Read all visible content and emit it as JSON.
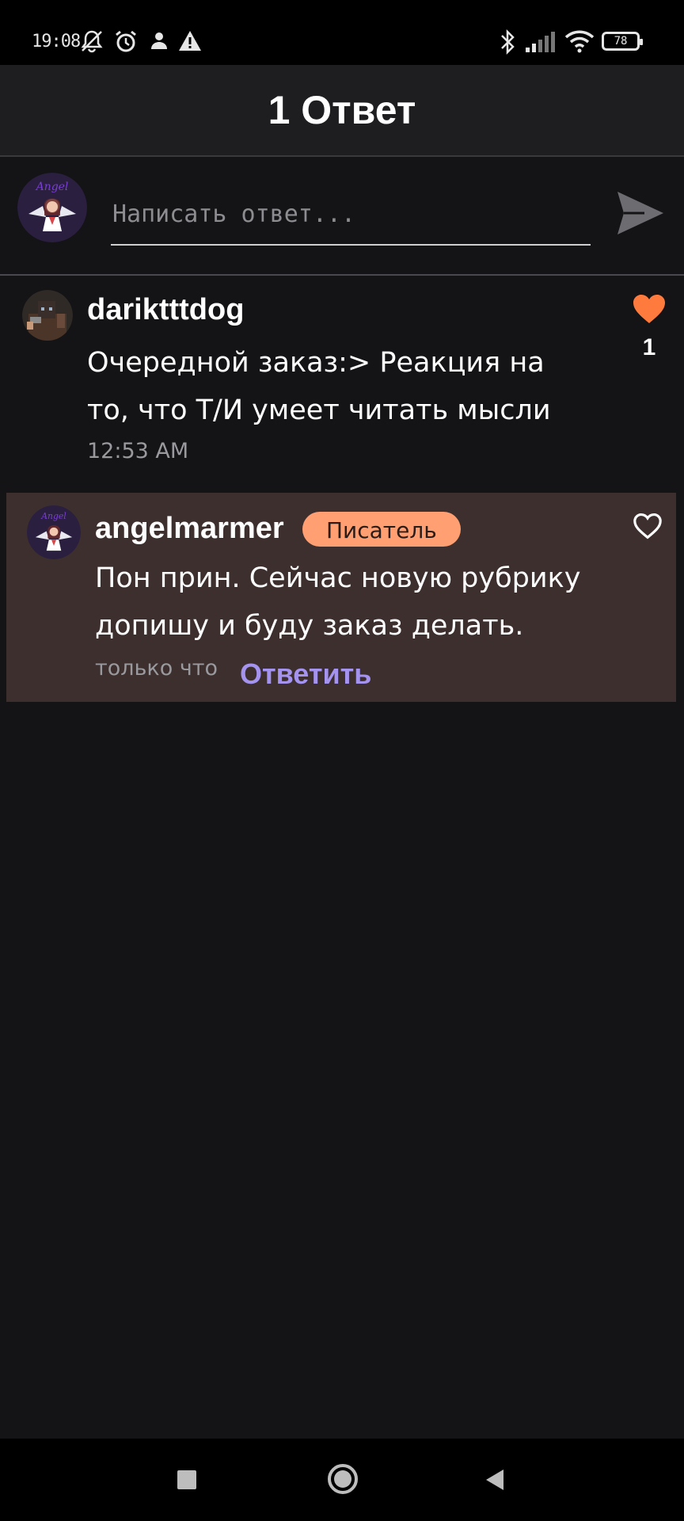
{
  "status_bar": {
    "time": "19:08",
    "battery": "78",
    "icons": [
      "muted-bell-icon",
      "alarm-icon",
      "person-icon",
      "warning-icon",
      "bluetooth-icon",
      "signal-icon",
      "wifi-icon",
      "battery-icon"
    ]
  },
  "header": {
    "title": "1 Ответ"
  },
  "composer": {
    "placeholder": "Написать ответ...",
    "send_icon": "send-icon"
  },
  "comments": [
    {
      "username": "dariktttdog",
      "text": "Очередной заказ:> Реакция на то, что Т/И умеет читать мысли",
      "time": "12:53 AM",
      "likes": "1",
      "liked": true
    },
    {
      "username": "angelmarmer",
      "badge": "Писатель",
      "text": "Пон прин. Сейчас новую рубрику допишу и буду заказ делать.",
      "time": "только что",
      "reply_label": "Ответить",
      "liked": false
    }
  ],
  "colors": {
    "background": "#141316",
    "header": "#1e1d20",
    "reply_highlight": "#3c2f2e",
    "badge": "#ff9f72",
    "like": "#ff7a3d",
    "link": "#a593f0"
  },
  "nav_bar": {
    "icons": [
      "recents-square-icon",
      "home-circle-icon",
      "back-triangle-icon"
    ]
  }
}
